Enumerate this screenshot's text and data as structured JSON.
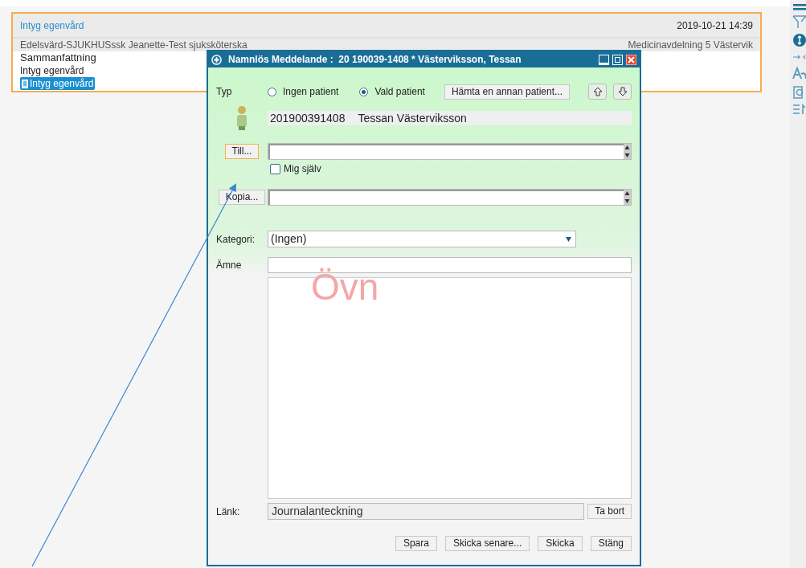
{
  "record": {
    "title": "Intyg egenvård",
    "timestamp": "2019-10-21 14:39",
    "author": "Edelsvärd-SJUKHUSssk Jeanette-Test sjuksköterska",
    "department": "Medicinavdelning 5 Västervik",
    "items": [
      {
        "label": "Sammanfattning",
        "kind": "heading",
        "selected": false
      },
      {
        "label": "Intyg egenvård",
        "kind": "text",
        "selected": false
      },
      {
        "label": "Intyg egenvård",
        "kind": "document",
        "selected": true
      }
    ]
  },
  "dialog": {
    "title": "Namnlös Meddelande :  20 190039-1408 * Västerviksson, Tessan",
    "type_label": "Typ",
    "type_options": [
      {
        "label": "Ingen patient",
        "selected": false
      },
      {
        "label": "Vald patient",
        "selected": true
      }
    ],
    "fetch_button": "Hämta en annan patient...",
    "patient_id": "201900391408",
    "patient_name": "Tessan Västerviksson",
    "to_button": {
      "label": "Till...",
      "focused": true
    },
    "myself": {
      "label": "Mig själv",
      "checked": false
    },
    "copy_button": {
      "label": "Kopia...",
      "focused": false
    },
    "category_label": "Kategori:",
    "category_value": "(Ingen)",
    "subject_label": "Ämne",
    "watermark": "Övn",
    "link_label": "Länk:",
    "link_value": "Journalanteckning",
    "remove_button": "Ta bort",
    "buttons": [
      "Spara",
      "Skicka senare...",
      "Skicka",
      "Stäng"
    ]
  }
}
